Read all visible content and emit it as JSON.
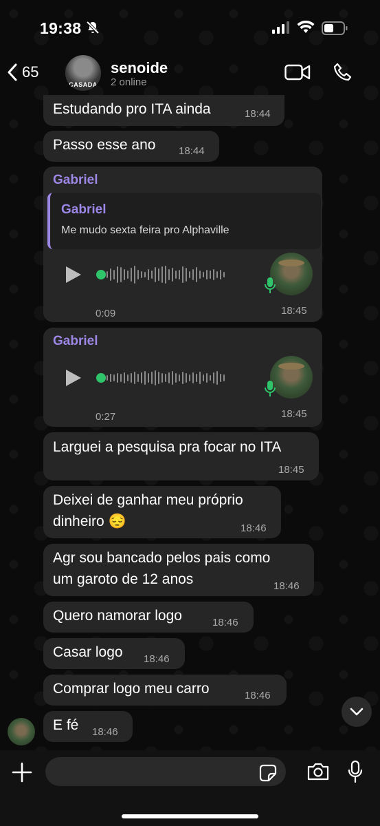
{
  "status_bar": {
    "time": "19:38"
  },
  "header": {
    "back_count": "65",
    "avatar_stamp": "CASADA",
    "title": "senoide",
    "subtitle": "2 online"
  },
  "messages": [
    {
      "text": "Estudando pro ITA ainda",
      "time": "18:44"
    },
    {
      "text": "Passo esse ano",
      "time": "18:44"
    },
    {
      "sender": "Gabriel",
      "quote_name": "Gabriel",
      "quote_text": "Me mudo sexta feira pro Alphaville",
      "duration": "0:09",
      "time": "18:45"
    },
    {
      "sender": "Gabriel",
      "duration": "0:27",
      "time": "18:45"
    },
    {
      "text": "Larguei a pesquisa pra focar no ITA",
      "time": "18:45"
    },
    {
      "text_line1": "Deixei de ganhar meu próprio",
      "text_line2": "dinheiro 😔",
      "time": "18:46"
    },
    {
      "text_line1": "Agr sou bancado pelos pais como",
      "text_line2": "um garoto de 12 anos",
      "time": "18:46"
    },
    {
      "text": "Quero namorar logo",
      "time": "18:46"
    },
    {
      "text": "Casar logo",
      "time": "18:46"
    },
    {
      "text": "Comprar logo meu carro",
      "time": "18:46"
    },
    {
      "text": "E fé",
      "time": "18:46"
    }
  ],
  "input": {
    "placeholder": ""
  },
  "colors": {
    "accent": "#9d87e6",
    "bubble": "#262626",
    "green": "#30c46a"
  }
}
